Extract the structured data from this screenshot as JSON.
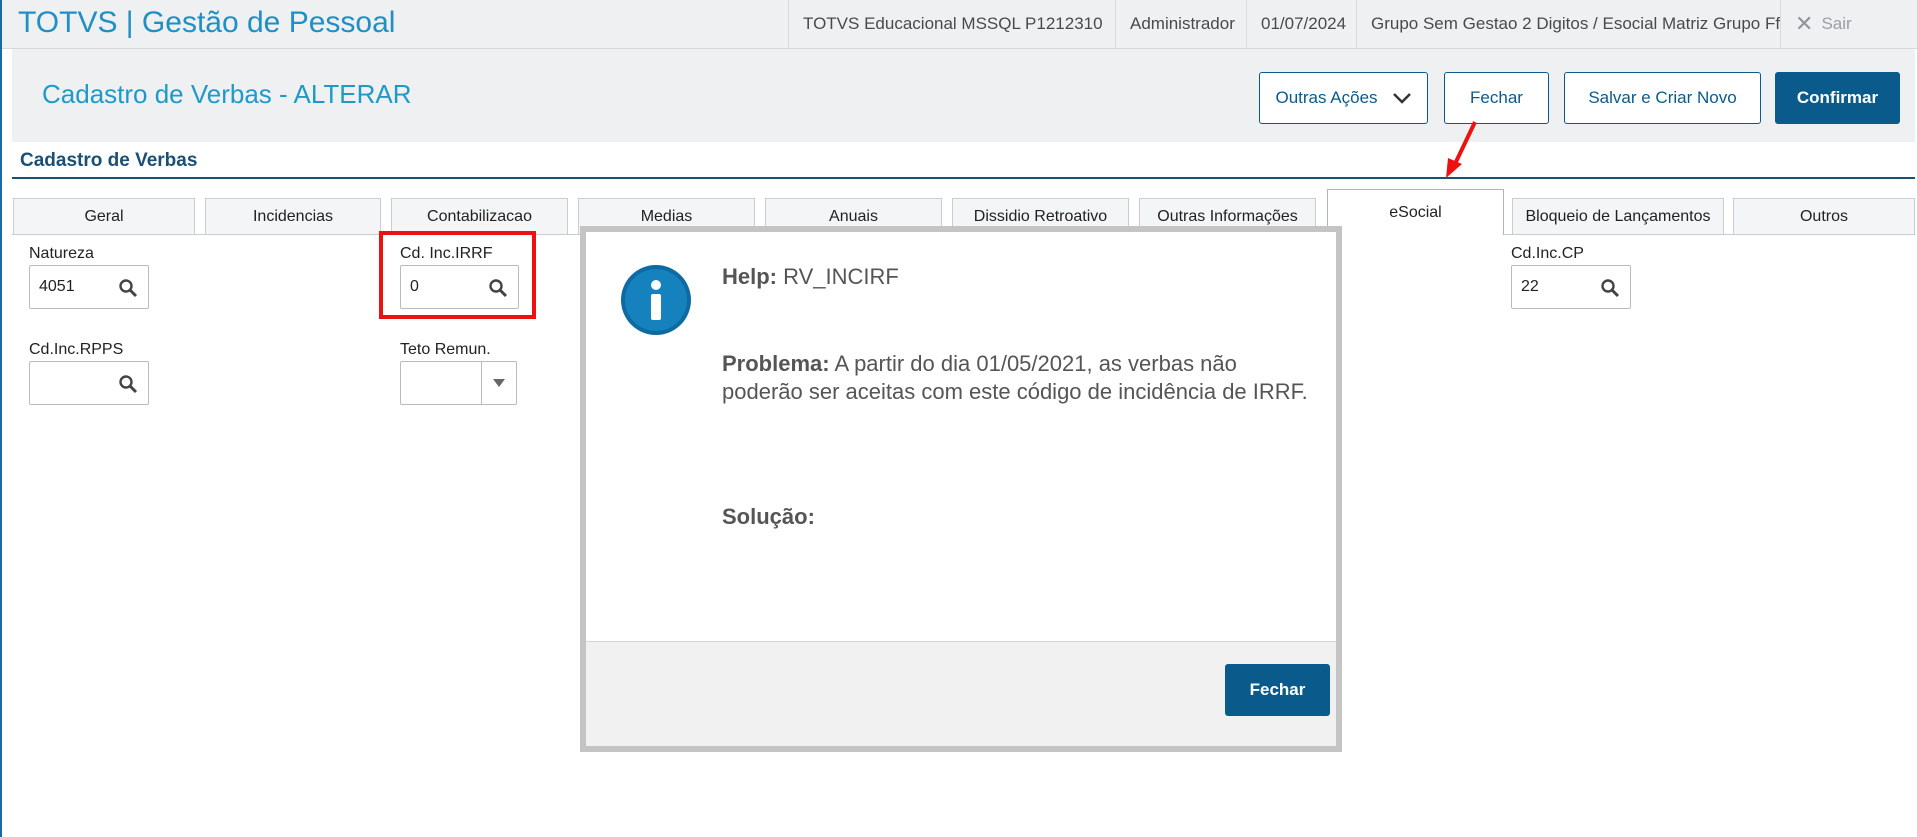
{
  "topbar": {
    "app_title": "TOTVS | Gestão de Pessoal",
    "environment": "TOTVS Educacional MSSQL P1212310",
    "user": "Administrador",
    "date": "01/07/2024",
    "company": "Grupo Sem Gestao 2 Digitos / Esocial Matriz Grupo Ff",
    "exit_label": "Sair"
  },
  "header": {
    "title": "Cadastro de Verbas - ALTERAR",
    "buttons": {
      "other_actions": "Outras Ações",
      "close": "Fechar",
      "save_new": "Salvar e Criar Novo",
      "confirm": "Confirmar"
    }
  },
  "section": {
    "title": "Cadastro de Verbas"
  },
  "tabs": [
    "Geral",
    "Incidencias",
    "Contabilizacao",
    "Medias",
    "Anuais",
    "Dissidio Retroativo",
    "Outras Informações",
    "eSocial",
    "Bloqueio de Lançamentos",
    "Outros"
  ],
  "active_tab": "eSocial",
  "fields": {
    "natureza": {
      "label": "Natureza",
      "value": "4051"
    },
    "cd_inc_irrf": {
      "label": "Cd. Inc.IRRF",
      "value": "0"
    },
    "cd_inc_cp": {
      "label": "Cd.Inc.CP",
      "value": "22"
    },
    "cd_inc_rpps": {
      "label": "Cd.Inc.RPPS",
      "value": ""
    },
    "teto_remun": {
      "label": "Teto Remun.",
      "value": ""
    }
  },
  "dialog": {
    "help_label": "Help:",
    "help_code": "RV_INCIRF",
    "problem_label": "Problema:",
    "problem_text": "A partir do dia 01/05/2021, as verbas não poderão ser aceitas com este código de incidência de IRRF.",
    "solution_label": "Solução:",
    "close_button": "Fechar"
  },
  "colors": {
    "brand_blue": "#1f8fc4",
    "primary_button": "#0b5a8c",
    "highlight_red": "#ee1111"
  }
}
